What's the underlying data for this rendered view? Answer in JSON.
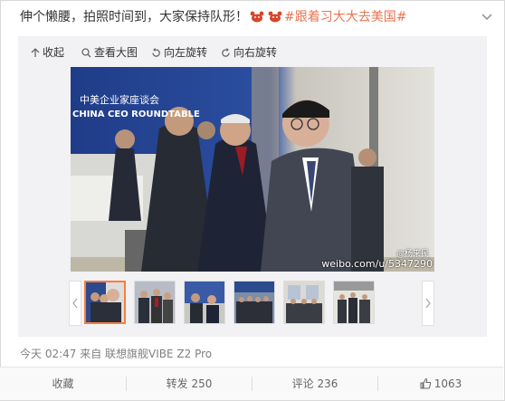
{
  "post": {
    "text_prefix": "伸个懒腰，拍照时间到，大家保持队形！",
    "emoji_names": [
      "crab-emoji",
      "crab-emoji"
    ],
    "hashtag": "#跟着习大大去美国#"
  },
  "toolbar": {
    "collapse": "收起",
    "view_large": "查看大图",
    "rotate_left": "向左旋转",
    "rotate_right": "向右旋转"
  },
  "photo": {
    "banner_cn": "中美企业家座谈会",
    "banner_en": "CHINA CEO ROUNDTABLE",
    "watermark": "weibo.com/u/5347290",
    "watermark_handle": "@杨来民"
  },
  "thumbnails": {
    "count": 6,
    "active_index": 0
  },
  "meta": {
    "time": "今天 02:47",
    "source": "来自 联想旗舰VIBE Z2 Pro"
  },
  "actions": {
    "favorite": "收藏",
    "repost": "转发 250",
    "comment": "评论 236",
    "like": "1063"
  },
  "colors": {
    "hashtag": "#eb7350",
    "active_thumb_border": "#fa7d3c",
    "media_background": "#f2f2f5"
  }
}
